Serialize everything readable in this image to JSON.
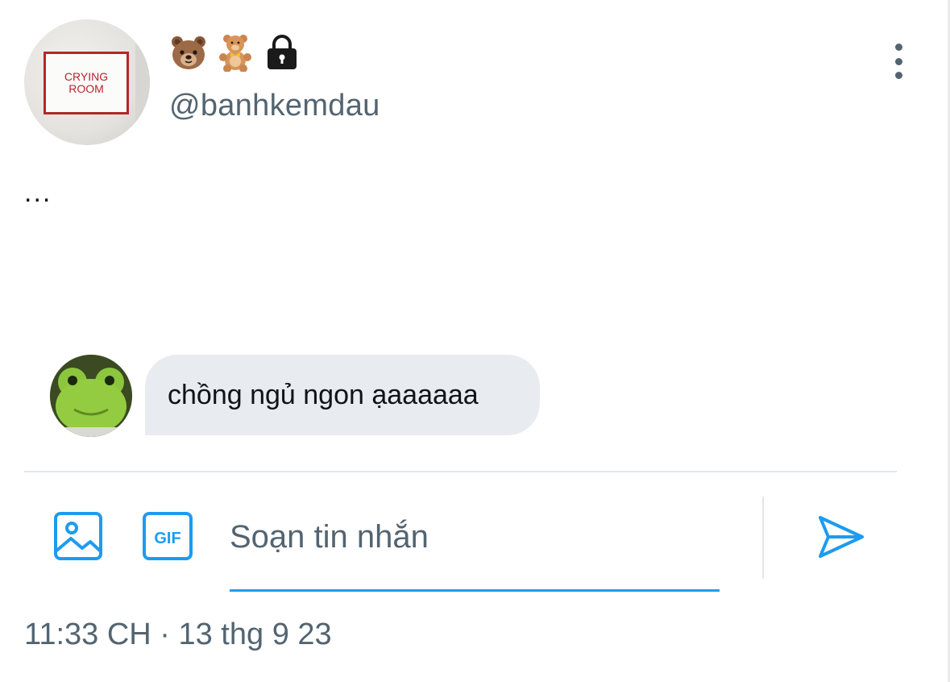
{
  "header": {
    "display_name_emojis": [
      "bear-face-icon",
      "teddy-bear-icon",
      "lock-icon"
    ],
    "handle": "@banhkemdau",
    "avatar_sign_text": "CRYING\nROOM"
  },
  "bio": {
    "text": "..."
  },
  "messages": [
    {
      "avatar": "frog-plush-avatar",
      "text": "chồng ngủ ngon ạaaaaaa"
    }
  ],
  "composer": {
    "image_icon": "image-icon",
    "gif_icon": "gif-icon",
    "gif_label": "GIF",
    "placeholder": "Soạn tin nhắn",
    "send_icon": "send-icon"
  },
  "meta": {
    "timestamp": "11:33 CH · 13 thg 9 23"
  },
  "colors": {
    "accent": "#1d9bf0",
    "secondary_text": "#536471",
    "primary_text": "#0f1419",
    "bubble_bg": "#e8ecf0",
    "divider": "#e1e6ea"
  }
}
